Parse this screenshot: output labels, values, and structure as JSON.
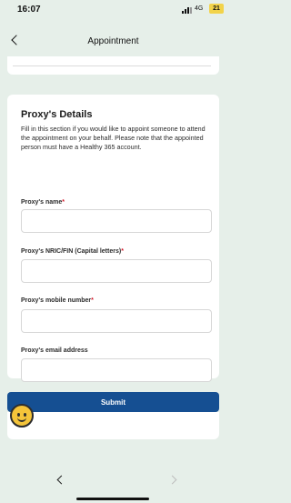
{
  "status_bar": {
    "time": "16:07",
    "network": "4G",
    "battery": "21"
  },
  "nav": {
    "title": "Appointment",
    "back_icon": "chevron-left-icon"
  },
  "proxy": {
    "title": "Proxy's Details",
    "description": "Fill in this section if you would like to appoint someone to attend the appointment on your behalf. Please note that the appointed person must have a Healthy 365 account.",
    "required_marker": "*",
    "fields": [
      {
        "label": "Proxy's name",
        "required": true,
        "value": "",
        "placeholder": ""
      },
      {
        "label": "Proxy's NRIC/FIN (Capital letters)",
        "required": true,
        "value": "",
        "placeholder": ""
      },
      {
        "label": "Proxy's mobile number",
        "required": true,
        "value": "",
        "placeholder": ""
      },
      {
        "label": "Proxy's email address",
        "required": false,
        "value": "",
        "placeholder": ""
      }
    ]
  },
  "submit": {
    "label": "Submit"
  },
  "browser": {
    "prev_icon": "chevron-left-icon",
    "next_icon": "chevron-right-icon"
  },
  "colors": {
    "background": "#e6efe9",
    "card": "#ffffff",
    "primary": "#154f92",
    "required": "#d11a2a",
    "battery": "#f2d34a",
    "chat_bubble": "#f4c43a"
  }
}
